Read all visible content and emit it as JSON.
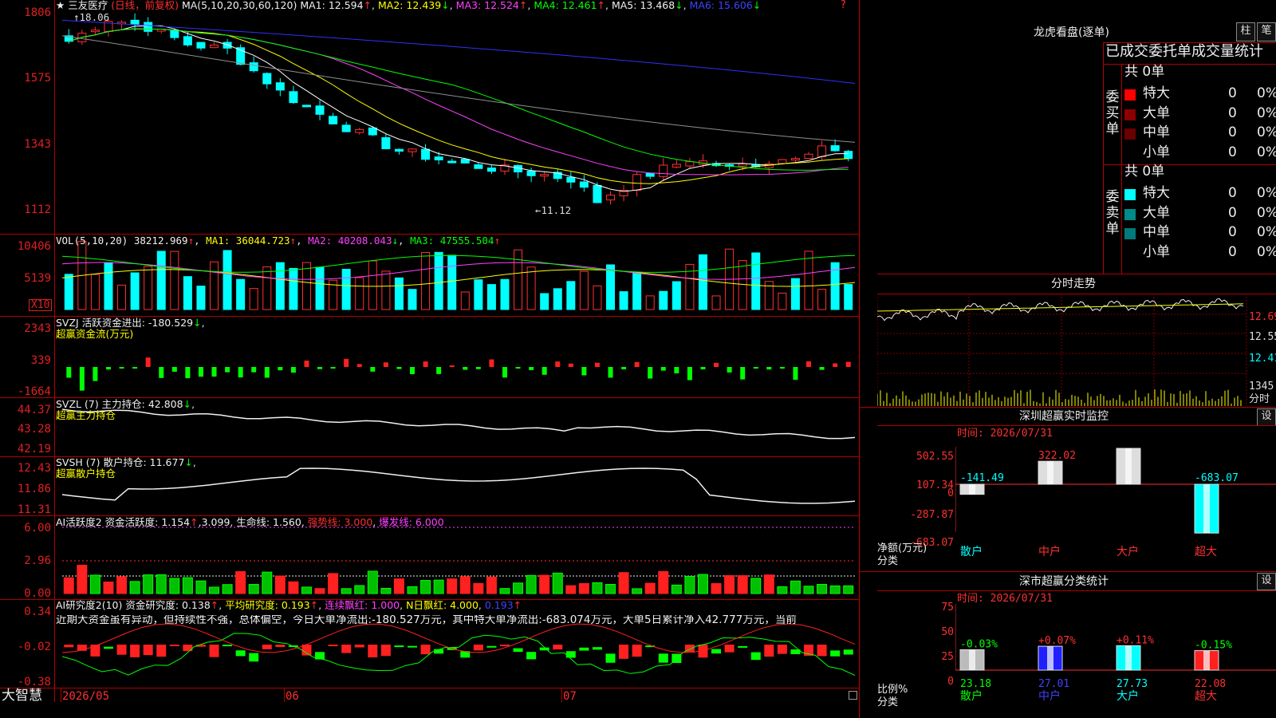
{
  "stock": {
    "name": "三友医疗",
    "period": "(日线，前复权)"
  },
  "ma_line": {
    "label": "MA(5,10,20,30,60,120)",
    "ma1": "MA1: 12.594",
    "ma2": "MA2: 12.439",
    "ma3": "MA3: 12.524",
    "ma4": "MA4: 12.461",
    "ma5": "MA5: 13.468",
    "ma6": "MA6: 15.606"
  },
  "annotations": {
    "high": "18.06",
    "low": "←11.12"
  },
  "vol_line": {
    "label": "VOL(5,10,20)",
    "v": "38212.969",
    "ma1": "MA1: 36044.723",
    "ma2": "MA2: 40208.043",
    "ma3": "MA3: 47555.504"
  },
  "vol_unit": "X10",
  "svzj": {
    "label": "SVZJ  活跃资金进出: -180.529",
    "sub": "超赢资金流(万元)"
  },
  "svzl": {
    "label": "SVZL (7) 主力持仓: 42.808",
    "sub": "超赢主力持仓"
  },
  "svsh": {
    "label": "SVSH (7) 散户持仓: 11.677",
    "sub": "超赢散户持仓"
  },
  "ai1": {
    "a": "AI活跃度2 资金活跃度: 1.154",
    "b": "3.099",
    "c": "生命线: 1.560",
    "d": "强势线: 3.000",
    "e": "爆发线: 6.000"
  },
  "ai2": {
    "a": "AI研究度2(10) 资金研究度: 0.138",
    "b": "平均研究度: 0.193",
    "c": "连续飘红: 1.000",
    "d": "N日飘红: 4.000",
    "e": "0.193"
  },
  "ai2_text": "近期大资金虽有异动，但持续性不强，总体偏空，今日大单净流出:-180.527万元，其中特大单净流出:-683.074万元，大单5日累计净入42.777万元，当前",
  "axes": {
    "price": [
      "1806",
      "1575",
      "1343",
      "1112"
    ],
    "vol": [
      "10406",
      "5139"
    ],
    "svzj": [
      "2343",
      "339",
      "-1664"
    ],
    "svzl": [
      "44.37",
      "43.28",
      "42.19"
    ],
    "svsh": [
      "12.43",
      "11.86",
      "11.31"
    ],
    "ai1": [
      "6.00",
      "2.96",
      "0.00"
    ],
    "ai2": [
      "0.34",
      "-0.02",
      "-0.38"
    ]
  },
  "bottom": {
    "brand": "大智慧",
    "d1": "2026/05",
    "d2": "06",
    "d3": "07"
  },
  "right": {
    "title": "龙虎看盘(逐单)",
    "tab1": "柱",
    "tab2": "笔",
    "heading": "已成交委托单成交量统计",
    "buy_label": "委买单",
    "sell_label": "委卖单",
    "buy_total": "共 0单",
    "sell_total": "共 0单",
    "rows": [
      {
        "name": "特大",
        "n": "0",
        "p": "0%"
      },
      {
        "name": "大单",
        "n": "0",
        "p": "0%"
      },
      {
        "name": "中单",
        "n": "0",
        "p": "0%"
      },
      {
        "name": "小单",
        "n": "0",
        "p": "0%"
      }
    ],
    "fenshi_title": "分时走势",
    "fenshi_axis": [
      "12.69",
      "12.55",
      "12.41",
      "1345",
      "分时"
    ],
    "sz_title": "深圳超赢实时监控",
    "sz_time": "时间: 2026/07/31",
    "sz_axis": [
      "502.55",
      "107.34",
      "0",
      "-287.87",
      "-683.07"
    ],
    "sz_ylabel": "净额(万元)",
    "sz_xlabel": "分类",
    "cat_title": "深市超赢分类统计",
    "cat_time": "时间: 2026/07/31",
    "cat_axis": [
      "75",
      "50",
      "25",
      "0"
    ],
    "cat_ylabel": "比例%",
    "cat_xlabel": "分类",
    "set": "设"
  },
  "colors": {
    "up": "#ff3030",
    "down": "#00ffff",
    "grid": "#b00000"
  },
  "chart_data": [
    {
      "type": "bar",
      "title": "深圳超赢实时监控",
      "categories": [
        "散户",
        "中户",
        "大户",
        "超大"
      ],
      "values": [
        -141.49,
        322.02,
        502.55,
        -683.07
      ],
      "ylabel": "净额(万元)",
      "xlabel": "分类",
      "ylim": [
        -683.07,
        502.55
      ]
    },
    {
      "type": "bar",
      "title": "深市超赢分类统计",
      "categories": [
        "散户",
        "中户",
        "大户",
        "超大"
      ],
      "values": [
        23.18,
        27.01,
        27.73,
        22.08
      ],
      "changes": [
        "-0.03%",
        "+0.07%",
        "+0.11%",
        "-0.15%"
      ],
      "ylabel": "比例%",
      "xlabel": "分类",
      "ylim": [
        0,
        75
      ]
    },
    {
      "type": "line",
      "title": "三友医疗 (日线，前复权)",
      "xlabel": "",
      "ylabel": "",
      "x_ticks": [
        "2026/05",
        "06",
        "07"
      ],
      "ylim": [
        11.12,
        18.06
      ],
      "series": [
        {
          "name": "MA1",
          "last": 12.594
        },
        {
          "name": "MA2",
          "last": 12.439
        },
        {
          "name": "MA3",
          "last": 12.524
        },
        {
          "name": "MA4",
          "last": 12.461
        },
        {
          "name": "MA5",
          "last": 13.468
        },
        {
          "name": "MA6",
          "last": 15.606
        }
      ]
    }
  ]
}
